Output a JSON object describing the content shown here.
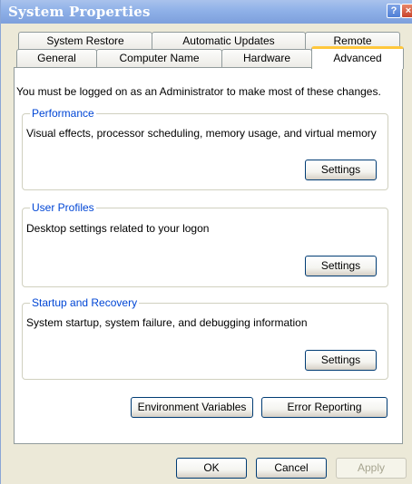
{
  "window": {
    "title": "System Properties"
  },
  "titlebar": {
    "help_glyph": "?",
    "close_glyph": "×"
  },
  "tabs": {
    "row1": [
      "System Restore",
      "Automatic Updates",
      "Remote"
    ],
    "row2": [
      "General",
      "Computer Name",
      "Hardware",
      "Advanced"
    ],
    "active": "Advanced"
  },
  "intro_text": "You must be logged on as an Administrator to make most of these changes.",
  "groups": {
    "performance": {
      "label": "Performance",
      "description": "Visual effects, processor scheduling, memory usage, and virtual memory",
      "button": "Settings"
    },
    "user_profiles": {
      "label": "User Profiles",
      "description": "Desktop settings related to your logon",
      "button": "Settings"
    },
    "startup_recovery": {
      "label": "Startup and Recovery",
      "description": "System startup, system failure, and debugging information",
      "button": "Settings"
    }
  },
  "buttons": {
    "environment_variables": "Environment Variables",
    "error_reporting": "Error Reporting",
    "ok": "OK",
    "cancel": "Cancel",
    "apply": "Apply"
  },
  "icons": {
    "help": "help-icon",
    "close": "close-icon"
  },
  "colors": {
    "titlebar": "#8fb1e8",
    "dialog_bg": "#ece9d8",
    "group_label": "#0046d5",
    "active_tab_accent": "#ffc73c",
    "close_button": "#c8432a"
  }
}
